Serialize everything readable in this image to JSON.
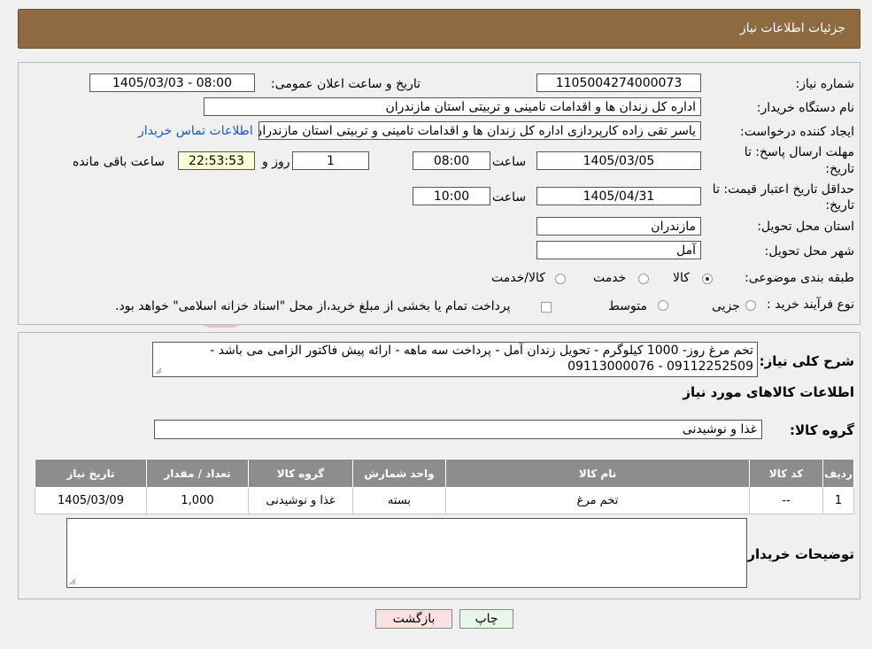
{
  "page": {
    "title": "جزئیات اطلاعات نیاز"
  },
  "form": {
    "need_number_label": "شماره نیاز:",
    "need_number": "1105004274000073",
    "announce_label": "تاریخ و ساعت اعلان عمومی:",
    "announce_value": "1405/03/03 - 08:00",
    "buyer_org_label": "نام دستگاه خریدار:",
    "buyer_org": "اداره کل زندان ها و اقدامات تامینی و تربیتی استان مازندران",
    "creator_label": "ایجاد کننده درخواست:",
    "creator": "یاسر تقی زاده کارپردازی اداره کل زندان ها و اقدامات تامینی و تربیتی استان مازندران",
    "contact_link": "اطلاعات تماس خریدار",
    "deadline_label_1": "مهلت ارسال پاسخ: تا",
    "deadline_label_2": "تاریخ:",
    "deadline_date": "1405/03/05",
    "time_label": "ساعت",
    "deadline_time": "08:00",
    "days_value": "1",
    "days_label": "روز و",
    "remaining_time": "22:53:53",
    "remaining_label": "ساعت باقی مانده",
    "validity_label_1": "حداقل تاریخ اعتبار قیمت: تا",
    "validity_label_2": "تاریخ:",
    "validity_date": "1405/04/31",
    "validity_time": "10:00",
    "province_label": "استان محل تحویل:",
    "province": "مازندران",
    "city_label": "شهر محل تحویل:",
    "city": "آمل",
    "category_label": "طبقه بندی موضوعی:",
    "category_options": [
      "کالا",
      "خدمت",
      "کالا/خدمت"
    ],
    "process_label": "نوع فرآیند خرید :",
    "process_options": [
      "جزیی",
      "متوسط"
    ],
    "process_note": "پرداخت تمام یا بخشی از مبلغ خرید،از محل \"اسناد خزانه اسلامی\" خواهد بود."
  },
  "description": {
    "label": "شرح کلی نیاز:",
    "text_line1": "تخم مرغ روز- 1000 کیلوگرم -  تحویل زندان آمل - پرداخت سه ماهه - ارائه پیش فاکتور الزامی می باشد -",
    "text_line2": "09112252509 - 09113000076"
  },
  "goods": {
    "section_title": "اطلاعات کالاهای مورد نیاز",
    "group_label": "گروه کالا:",
    "group_value": "غذا و نوشیدنی",
    "columns": [
      "ردیف",
      "کد کالا",
      "نام کالا",
      "واحد شمارش",
      "گروه کالا",
      "تعداد / مقدار",
      "تاریخ نیاز"
    ],
    "rows": [
      [
        "1",
        "--",
        "تخم مرغ",
        "بسته",
        "غذا و نوشیدنی",
        "1,000",
        "1405/03/09"
      ]
    ]
  },
  "buyer_notes": {
    "label": "توضیحات خریدار:",
    "value": ""
  },
  "buttons": {
    "print": "چاپ",
    "back": "بازگشت"
  },
  "watermark": {
    "text": "AriaTender.neT"
  }
}
